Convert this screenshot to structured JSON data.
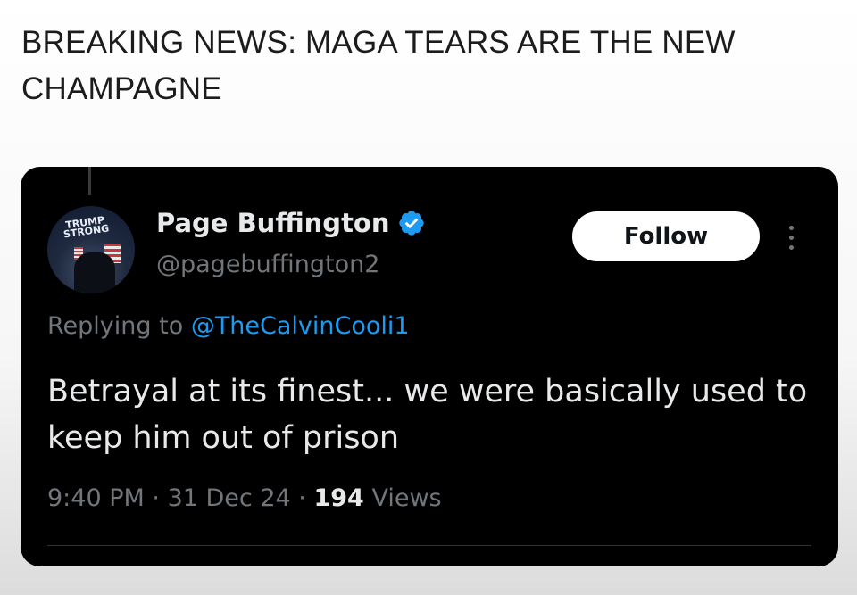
{
  "headline": "BREAKING NEWS: MAGA TEARS ARE THE NEW CHAMPAGNE",
  "tweet": {
    "avatar": {
      "badge_text": "TRUMP STRONG",
      "icon": "profile-avatar"
    },
    "display_name": "Page Buffington",
    "verified_icon": "verified-badge-icon",
    "verified_color": "#1d9bf0",
    "handle": "@pagebuffington2",
    "follow_label": "Follow",
    "more_icon": "more-options-icon",
    "replying_prefix": "Replying to",
    "replying_to": "@TheCalvinCooli1",
    "body": "Betrayal at its finest... we were basically used to keep him out of prison",
    "time": "9:40 PM",
    "separator": "·",
    "date": "31 Dec 24",
    "views_count": "194",
    "views_label": "Views"
  },
  "colors": {
    "card_bg": "#000000",
    "primary_text": "#e7e9ea",
    "secondary_text": "#71767b",
    "link": "#1d9bf0"
  }
}
